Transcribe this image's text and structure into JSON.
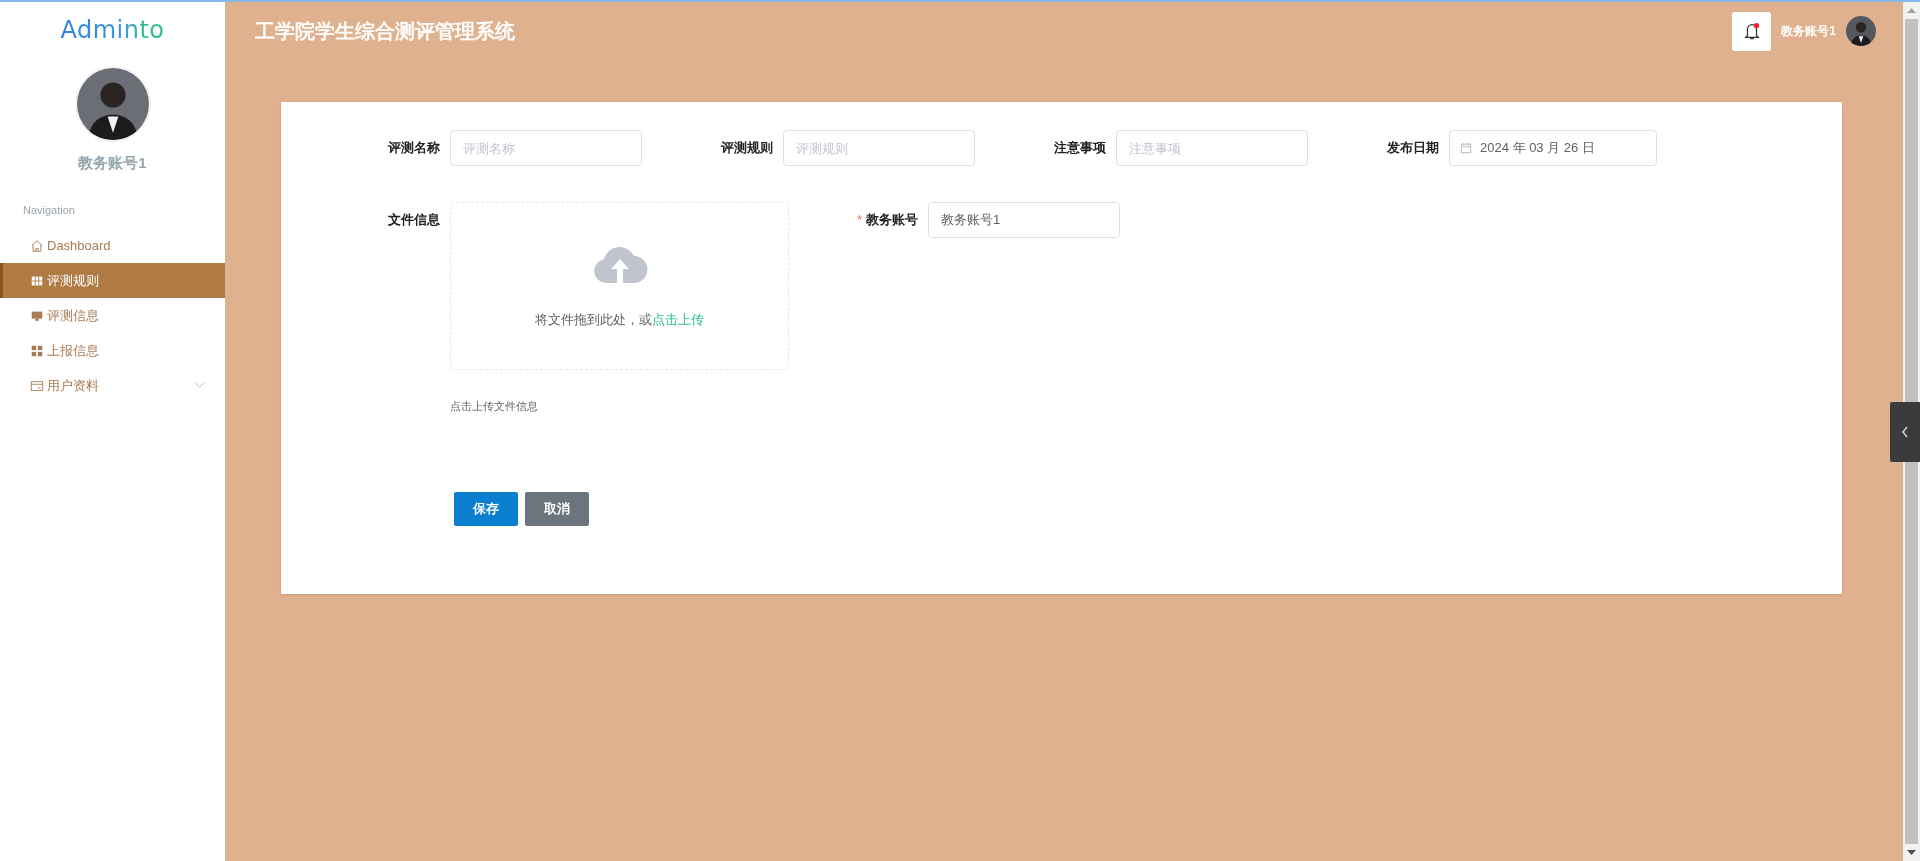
{
  "sidebar": {
    "logo": "Adminto",
    "user_name": "教务账号1",
    "section_title": "Navigation",
    "items": [
      {
        "label": "Dashboard",
        "kind": "home",
        "selected": false
      },
      {
        "label": "评测规则",
        "kind": "grid",
        "selected": true
      },
      {
        "label": "评测信息",
        "kind": "monitor",
        "selected": false
      },
      {
        "label": "上报信息",
        "kind": "tiles",
        "selected": false
      },
      {
        "label": "用户资料",
        "kind": "card",
        "selected": false,
        "expanded": false
      }
    ]
  },
  "header": {
    "title": "工学院学生综合测评管理系统",
    "notification": true,
    "user_name": "教务账号1"
  },
  "form": {
    "fields": [
      {
        "label": "评测名称",
        "kind": "text",
        "placeholder": "评测名称"
      },
      {
        "label": "评测规则",
        "kind": "text",
        "placeholder": "评测规则"
      },
      {
        "label": "注意事项",
        "kind": "text",
        "placeholder": "注意事项"
      },
      {
        "label": "发布日期",
        "kind": "date",
        "value": "2024 年 03 月 26 日"
      }
    ],
    "upload": {
      "label": "文件信息",
      "prompt": "将文件拖到此处，或",
      "link": "点击上传",
      "hint": "点击上传文件信息"
    },
    "account": {
      "required_mark": "*",
      "label": "教务账号",
      "value": "教务账号1"
    },
    "buttons": [
      {
        "label": "保存",
        "kind": "primary"
      },
      {
        "label": "取消",
        "kind": "secondary"
      }
    ]
  }
}
